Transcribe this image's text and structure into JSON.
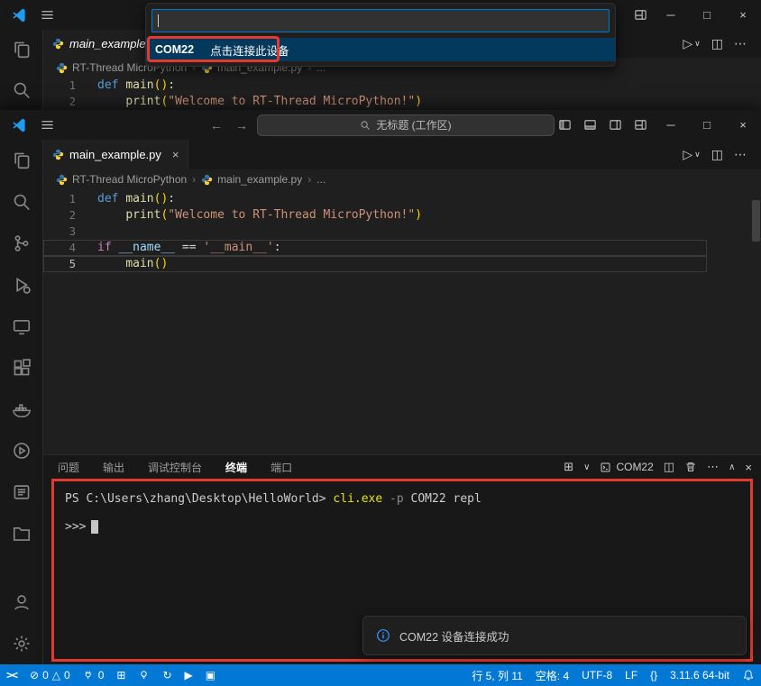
{
  "colors": {
    "accent": "#0078d4",
    "statusbar_bg": "#0078d4",
    "annotation_red": "#e23a2e",
    "quickpick_selected_bg": "#04395e"
  },
  "icons": {
    "close": "×",
    "minimize": "─",
    "maximize": "□",
    "more": "⋯",
    "chevron_down": "∨",
    "chevron_up": "∧",
    "run": "▷",
    "split": "◫",
    "back": "←",
    "forward": "→",
    "error": "⊘",
    "warning": "△",
    "sync": "↻",
    "play": "▶",
    "stop": "▣",
    "grid": "⊞",
    "crumb_sep": "›",
    "remote": "><",
    "braces": "{}"
  },
  "quickpick": {
    "input_value": "",
    "item_device": "COM22",
    "item_hint": "点击连接此设备"
  },
  "top_window": {
    "tab_label": "main_example.p..."
  },
  "main_window": {
    "workspace_search": "无标题 (工作区)",
    "tab_label": "main_example.py"
  },
  "breadcrumb": {
    "items": [
      "RT-Thread MicroPython",
      "main_example.py",
      "..."
    ]
  },
  "code": {
    "lines": [
      {
        "num": "1",
        "tokens": [
          {
            "t": "def ",
            "c": "kw"
          },
          {
            "t": "main",
            "c": "fn"
          },
          {
            "t": "(",
            "c": "br"
          },
          {
            "t": ")",
            "c": "br"
          },
          {
            "t": ":",
            "c": "pl"
          }
        ]
      },
      {
        "num": "2",
        "tokens": [
          {
            "t": "    ",
            "c": ""
          },
          {
            "t": "print",
            "c": "fn"
          },
          {
            "t": "(",
            "c": "br"
          },
          {
            "t": "\"Welcome to RT-Thread MicroPython!\"",
            "c": "str"
          },
          {
            "t": ")",
            "c": "br"
          }
        ]
      },
      {
        "num": "3",
        "tokens": []
      },
      {
        "num": "4",
        "hl": true,
        "tokens": [
          {
            "t": "if ",
            "c": "ctrl"
          },
          {
            "t": "__name__",
            "c": "var"
          },
          {
            "t": " == ",
            "c": "pl"
          },
          {
            "t": "'__main__'",
            "c": "str"
          },
          {
            "t": ":",
            "c": "pl"
          }
        ]
      },
      {
        "num": "5",
        "hl": true,
        "cur": true,
        "tokens": [
          {
            "t": "    ",
            "c": ""
          },
          {
            "t": "main",
            "c": "fn"
          },
          {
            "t": "(",
            "c": "br"
          },
          {
            "t": ")",
            "c": "br"
          }
        ]
      }
    ]
  },
  "panel": {
    "tabs": [
      "问题",
      "输出",
      "调试控制台",
      "终端",
      "端口"
    ],
    "active_index": 3,
    "terminal_name": "COM22"
  },
  "terminal": {
    "line1": [
      {
        "t": "PS C:\\Users\\zhang\\Desktop\\HelloWorld> ",
        "c": ""
      },
      {
        "t": "cli.exe",
        "c": "tyellow"
      },
      {
        "t": " -p ",
        "c": "tdim"
      },
      {
        "t": "COM22 repl",
        "c": ""
      }
    ],
    "prompt": ">>>"
  },
  "notification": {
    "text": "COM22 设备连接成功"
  },
  "statusbar": {
    "errors": "0",
    "warnings": "0",
    "plug_count": "0",
    "cursor": "行 5, 列 11",
    "indent": "空格: 4",
    "encoding": "UTF-8",
    "eol": "LF",
    "interpreter": "3.11.6 64-bit"
  }
}
